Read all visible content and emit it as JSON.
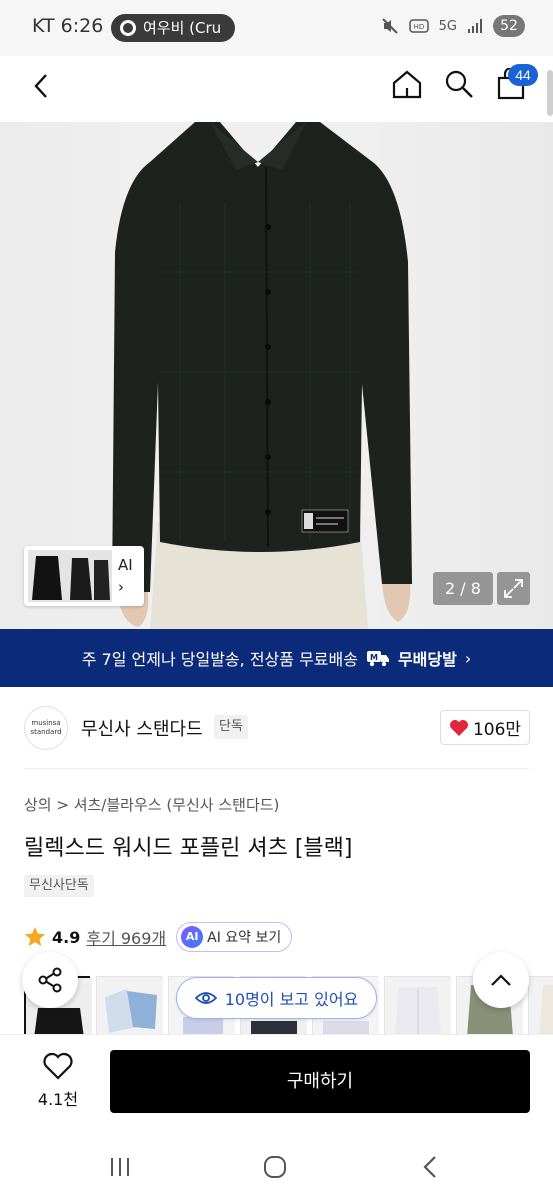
{
  "status_bar": {
    "carrier_time": "KT 6:26",
    "notification": "여우비 (Cru",
    "network": "5G",
    "battery": "52"
  },
  "header": {
    "cart_count": "44"
  },
  "product_image": {
    "thumb_label": "AI",
    "thumb_chevron": "›",
    "pager": "2 / 8"
  },
  "banner": {
    "text": "주 7일 언제나 당일발송, 전상품 무료배송",
    "badge": "무배당발",
    "chevron": "›"
  },
  "brand": {
    "logo_line1": "musinsa",
    "logo_line2": "standard",
    "name": "무신사 스탠다드",
    "tag": "단독",
    "likes": "106만"
  },
  "product": {
    "breadcrumb": "상의 > 셔츠/블라우스 (무신사 스탠다드)",
    "title": "릴렉스드 워시드 포플린 셔츠 [블랙]",
    "exclusive_badge": "무신사단독",
    "rating": "4.9",
    "reviews": "후기 969개",
    "ai_chip_icon": "AI",
    "ai_summary": "AI 요약 보기"
  },
  "viewers": "10명이 보고 있어요",
  "swatch_colors": [
    "#1a1a1a",
    "#cfdcec",
    "#f0f0f4",
    "#dcdce4",
    "#2a2f3a",
    "#e9e9ef",
    "#8a9077",
    "#ece8df"
  ],
  "buy_bar": {
    "wish_count": "4.1천",
    "buy_label": "구매하기"
  },
  "colors": {
    "banner_bg": "#0b2a7a",
    "badge_blue": "#1a63d6",
    "heart": "#e0263a",
    "star": "#f5a623"
  }
}
